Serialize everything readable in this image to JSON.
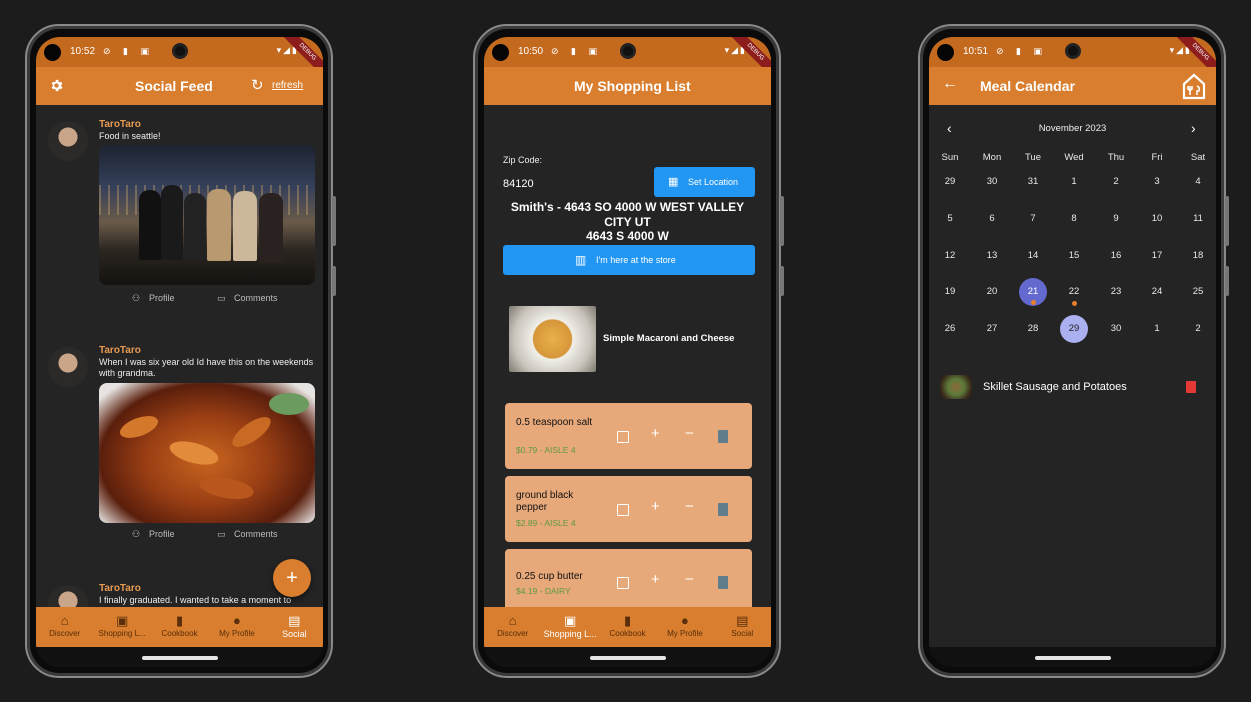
{
  "colors": {
    "accent": "#d87e2e",
    "status_bar": "#c46a1f",
    "screen_bg": "#242424",
    "card": "#e8a97a",
    "blue_button": "#2196f3",
    "calendar_selected": "#6469d0",
    "calendar_today": "#aab0f0"
  },
  "status_bar": {
    "debug_label": "DEBUG"
  },
  "phone1": {
    "time": "10:52",
    "title": "Social Feed",
    "settings_icon": "gear-icon",
    "refresh_label": "refresh",
    "posts": [
      {
        "user": "TaroTaro",
        "text": "Food in seattle!",
        "profile_label": "Profile",
        "comments_label": "Comments"
      },
      {
        "user": "TaroTaro",
        "text": "When I was six year old Id have this on the weekends with grandma.",
        "profile_label": "Profile",
        "comments_label": "Comments"
      },
      {
        "user": "TaroTaro",
        "text": "I finally graduated.  I wanted to take a moment to"
      }
    ],
    "fab_label": "+"
  },
  "phone2": {
    "time": "10:50",
    "title": "My Shopping List",
    "zip_label": "Zip Code:",
    "zip_value": "84120",
    "set_location_label": "Set Location",
    "store_line1": "Smith's - 4643 SO 4000 W WEST VALLEY",
    "store_line2": "CITY UT",
    "store_line3": "4643 S 4000 W",
    "at_store_label": "I'm here at the store",
    "recipe_name": "Simple Macaroni and Cheese",
    "ingredients": [
      {
        "name": "0.5 teaspoon salt",
        "price": "$0.79 - AISLE 4"
      },
      {
        "name": " ground black pepper",
        "price": "$2.89 - AISLE 4"
      },
      {
        "name": "0.25 cup butter",
        "price": "$4.19 - DAIRY"
      }
    ]
  },
  "phone3": {
    "time": "10:51",
    "title": "Meal Calendar",
    "month": "November 2023",
    "weekdays": [
      "Sun",
      "Mon",
      "Tue",
      "Wed",
      "Thu",
      "Fri",
      "Sat"
    ],
    "weeks": [
      [
        "29",
        "30",
        "31",
        "1",
        "2",
        "3",
        "4"
      ],
      [
        "5",
        "6",
        "7",
        "8",
        "9",
        "10",
        "11"
      ],
      [
        "12",
        "13",
        "14",
        "15",
        "16",
        "17",
        "18"
      ],
      [
        "19",
        "20",
        "21",
        "22",
        "23",
        "24",
        "25"
      ],
      [
        "26",
        "27",
        "28",
        "29",
        "30",
        "1",
        "2"
      ]
    ],
    "meal_name": "Skillet Sausage and Potatoes"
  },
  "nav": [
    {
      "label": "Discover",
      "icon": "home-icon"
    },
    {
      "label": "Shopping L...",
      "icon": "shopping-bag-icon"
    },
    {
      "label": "Cookbook",
      "icon": "book-icon"
    },
    {
      "label": "My Profile",
      "icon": "person-icon"
    },
    {
      "label": "Social",
      "icon": "feed-icon"
    }
  ]
}
